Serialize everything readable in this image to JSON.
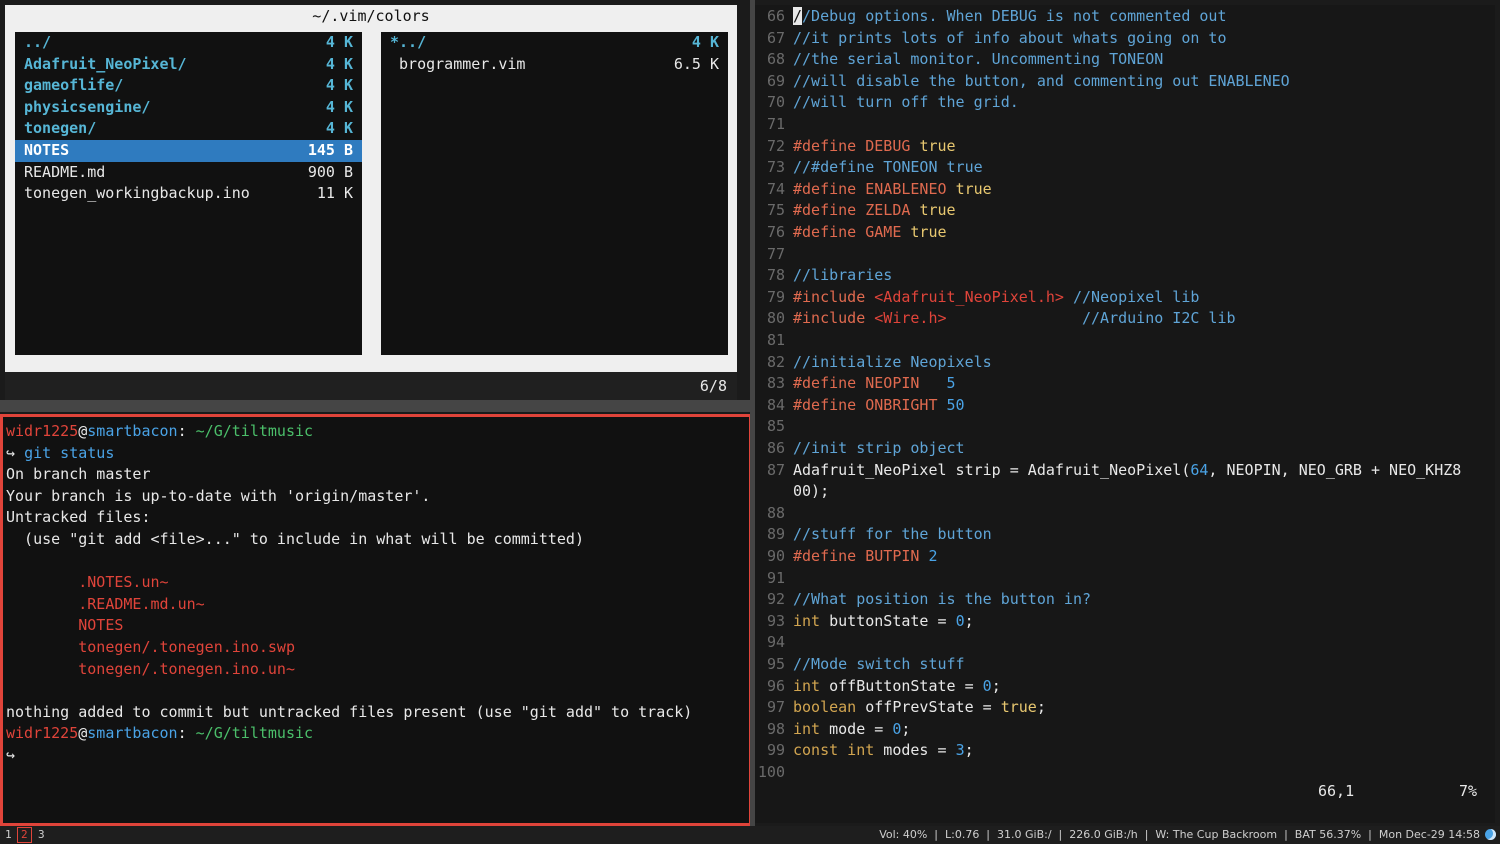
{
  "ranger": {
    "title": "~/.vim/colors",
    "left_entries": [
      {
        "name": "../",
        "size": "4 K",
        "type": "dir"
      },
      {
        "name": "Adafruit_NeoPixel/",
        "size": "4 K",
        "type": "dir"
      },
      {
        "name": "gameoflife/",
        "size": "4 K",
        "type": "dir"
      },
      {
        "name": "physicsengine/",
        "size": "4 K",
        "type": "dir"
      },
      {
        "name": "tonegen/",
        "size": "4 K",
        "type": "dir"
      },
      {
        "name": "NOTES",
        "size": "145 B",
        "type": "selected"
      },
      {
        "name": "README.md",
        "size": "900 B",
        "type": "file"
      },
      {
        "name": "tonegen_workingbackup.ino",
        "size": "11 K",
        "type": "file"
      }
    ],
    "right_entries": [
      {
        "name": "*../",
        "size": "4 K",
        "type": "dir"
      },
      {
        "name": " brogrammer.vim",
        "size": "6.5 K",
        "type": "file"
      }
    ],
    "position": "6/8"
  },
  "terminal": {
    "lines": [
      [
        {
          "t": "widr1225",
          "c": "red"
        },
        {
          "t": "@",
          "c": "white"
        },
        {
          "t": "smartbacon",
          "c": "blue"
        },
        {
          "t": ": ",
          "c": "white"
        },
        {
          "t": "~/G/tiltmusic",
          "c": "green"
        }
      ],
      [
        {
          "t": "↪ ",
          "c": "white"
        },
        {
          "t": "git status",
          "c": "blue"
        }
      ],
      [
        {
          "t": "On branch master",
          "c": "white"
        }
      ],
      [
        {
          "t": "Your branch is up-to-date with 'origin/master'.",
          "c": "white"
        }
      ],
      [
        {
          "t": "Untracked files:",
          "c": "white"
        }
      ],
      [
        {
          "t": "  (use \"git add <file>...\" to include in what will be committed)",
          "c": "white"
        }
      ],
      [
        {
          "t": "",
          "c": "white"
        }
      ],
      [
        {
          "t": "        .NOTES.un~",
          "c": "red"
        }
      ],
      [
        {
          "t": "        .README.md.un~",
          "c": "red"
        }
      ],
      [
        {
          "t": "        NOTES",
          "c": "red"
        }
      ],
      [
        {
          "t": "        tonegen/.tonegen.ino.swp",
          "c": "red"
        }
      ],
      [
        {
          "t": "        tonegen/.tonegen.ino.un~",
          "c": "red"
        }
      ],
      [
        {
          "t": "",
          "c": "white"
        }
      ],
      [
        {
          "t": "nothing added to commit but untracked files present (use \"git add\" to track)",
          "c": "white"
        }
      ],
      [
        {
          "t": "widr1225",
          "c": "red"
        },
        {
          "t": "@",
          "c": "white"
        },
        {
          "t": "smartbacon",
          "c": "blue"
        },
        {
          "t": ": ",
          "c": "white"
        },
        {
          "t": "~/G/tiltmusic",
          "c": "green"
        }
      ],
      [
        {
          "t": "↪",
          "c": "white"
        }
      ]
    ]
  },
  "vim": {
    "lines": [
      {
        "n": "66",
        "parts": [
          {
            "t": "/",
            "c": "cursor"
          },
          {
            "t": "/Debug options. When DEBUG is not commented out",
            "c": "cmt"
          }
        ]
      },
      {
        "n": "67",
        "parts": [
          {
            "t": "//it prints lots of info about whats going on to",
            "c": "cmt"
          }
        ]
      },
      {
        "n": "68",
        "parts": [
          {
            "t": "//the serial monitor. Uncommenting TONEON",
            "c": "cmt"
          }
        ]
      },
      {
        "n": "69",
        "parts": [
          {
            "t": "//will disable the button, and commenting out ENABLENEO",
            "c": "cmt"
          }
        ]
      },
      {
        "n": "70",
        "parts": [
          {
            "t": "//will turn off the grid.",
            "c": "cmt"
          }
        ]
      },
      {
        "n": "71",
        "parts": []
      },
      {
        "n": "72",
        "parts": [
          {
            "t": "#define DEBUG ",
            "c": "pre"
          },
          {
            "t": "true",
            "c": "kw"
          }
        ]
      },
      {
        "n": "73",
        "parts": [
          {
            "t": "//#define TONEON true",
            "c": "cmt"
          }
        ]
      },
      {
        "n": "74",
        "parts": [
          {
            "t": "#define ENABLENEO ",
            "c": "pre"
          },
          {
            "t": "true",
            "c": "kw"
          }
        ]
      },
      {
        "n": "75",
        "parts": [
          {
            "t": "#define ZELDA ",
            "c": "pre"
          },
          {
            "t": "true",
            "c": "kw"
          }
        ]
      },
      {
        "n": "76",
        "parts": [
          {
            "t": "#define GAME ",
            "c": "pre"
          },
          {
            "t": "true",
            "c": "kw"
          }
        ]
      },
      {
        "n": "77",
        "parts": []
      },
      {
        "n": "78",
        "parts": [
          {
            "t": "//libraries",
            "c": "cmt"
          }
        ]
      },
      {
        "n": "79",
        "parts": [
          {
            "t": "#include ",
            "c": "pre"
          },
          {
            "t": "<Adafruit_NeoPixel.h>",
            "c": "inc"
          },
          {
            "t": " //Neopixel lib",
            "c": "cmt"
          }
        ]
      },
      {
        "n": "80",
        "parts": [
          {
            "t": "#include ",
            "c": "pre"
          },
          {
            "t": "<Wire.h>",
            "c": "inc"
          },
          {
            "t": "               //Arduino I2C lib",
            "c": "cmt"
          }
        ]
      },
      {
        "n": "81",
        "parts": []
      },
      {
        "n": "82",
        "parts": [
          {
            "t": "//initialize Neopixels",
            "c": "cmt"
          }
        ]
      },
      {
        "n": "83",
        "parts": [
          {
            "t": "#define NEOPIN   ",
            "c": "pre"
          },
          {
            "t": "5",
            "c": "num"
          }
        ]
      },
      {
        "n": "84",
        "parts": [
          {
            "t": "#define ONBRIGHT ",
            "c": "pre"
          },
          {
            "t": "50",
            "c": "num"
          }
        ]
      },
      {
        "n": "85",
        "parts": []
      },
      {
        "n": "86",
        "parts": [
          {
            "t": "//init strip object",
            "c": "cmt"
          }
        ]
      },
      {
        "n": "87",
        "parts": [
          {
            "t": "Adafruit_NeoPixel strip = Adafruit_NeoPixel(",
            "c": "id"
          },
          {
            "t": "64",
            "c": "num"
          },
          {
            "t": ", NEOPIN, NEO_GRB + NEO_KHZ8",
            "c": "id"
          }
        ]
      },
      {
        "n": "",
        "parts": [
          {
            "t": "00);",
            "c": "id"
          }
        ]
      },
      {
        "n": "88",
        "parts": []
      },
      {
        "n": "89",
        "parts": [
          {
            "t": "//stuff for the button",
            "c": "cmt"
          }
        ]
      },
      {
        "n": "90",
        "parts": [
          {
            "t": "#define BUTPIN ",
            "c": "pre"
          },
          {
            "t": "2",
            "c": "num"
          }
        ]
      },
      {
        "n": "91",
        "parts": []
      },
      {
        "n": "92",
        "parts": [
          {
            "t": "//What position is the button in?",
            "c": "cmt"
          }
        ]
      },
      {
        "n": "93",
        "parts": [
          {
            "t": "int",
            "c": "typ"
          },
          {
            "t": " buttonState = ",
            "c": "id"
          },
          {
            "t": "0",
            "c": "num"
          },
          {
            "t": ";",
            "c": "id"
          }
        ]
      },
      {
        "n": "94",
        "parts": []
      },
      {
        "n": "95",
        "parts": [
          {
            "t": "//Mode switch stuff",
            "c": "cmt"
          }
        ]
      },
      {
        "n": "96",
        "parts": [
          {
            "t": "int",
            "c": "typ"
          },
          {
            "t": " offButtonState = ",
            "c": "id"
          },
          {
            "t": "0",
            "c": "num"
          },
          {
            "t": ";",
            "c": "id"
          }
        ]
      },
      {
        "n": "97",
        "parts": [
          {
            "t": "boolean",
            "c": "typ"
          },
          {
            "t": " offPrevState = ",
            "c": "id"
          },
          {
            "t": "true",
            "c": "kw"
          },
          {
            "t": ";",
            "c": "id"
          }
        ]
      },
      {
        "n": "98",
        "parts": [
          {
            "t": "int",
            "c": "typ"
          },
          {
            "t": " mode = ",
            "c": "id"
          },
          {
            "t": "0",
            "c": "num"
          },
          {
            "t": ";",
            "c": "id"
          }
        ]
      },
      {
        "n": "99",
        "parts": [
          {
            "t": "const int",
            "c": "typ"
          },
          {
            "t": " modes = ",
            "c": "id"
          },
          {
            "t": "3",
            "c": "num"
          },
          {
            "t": ";",
            "c": "id"
          }
        ]
      },
      {
        "n": "100",
        "parts": []
      }
    ],
    "cursor_pos": "66,1",
    "percent": "7%"
  },
  "bar": {
    "workspaces": [
      "1",
      "2",
      "3"
    ],
    "active_workspace": "2",
    "status": "Vol: 40%  |  L:0.76  |  31.0 GiB:/  |  226.0 GiB:/h  |  W: The Cup Backroom  |  BAT 56.37%  |  Mon Dec-29 14:58"
  },
  "colors": {
    "accent_red": "#e0443a",
    "selection_blue": "#2f7bbf",
    "dir_cyan": "#56b6d6"
  }
}
